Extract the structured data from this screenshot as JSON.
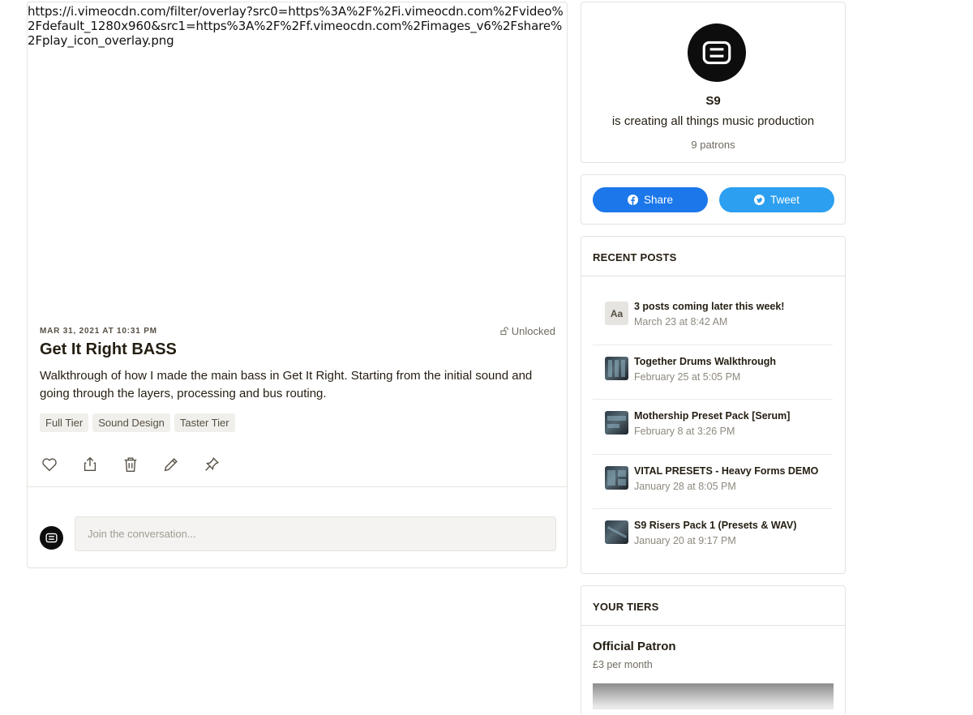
{
  "post": {
    "media_alt_text": "https://i.vimeocdn.com/filter/overlay?src0=https%3A%2F%2Fi.vimeocdn.com%2Fvideo%2Fdefault_1280x960&src1=https%3A%2F%2Ff.vimeocdn.com%2Fimages_v6%2Fshare%2Fplay_icon_overlay.png",
    "date": "MAR 31, 2021 AT 10:31 PM",
    "lock_status": "Unlocked",
    "title": "Get It Right BASS",
    "body": "Walkthrough of how I made the main bass in Get It Right. Starting from the initial sound and going through the layers, processing and bus routing.",
    "tags": [
      "Full Tier",
      "Sound Design",
      "Taster Tier"
    ],
    "actions": [
      "heart-icon",
      "share-icon",
      "trash-icon",
      "pencil-icon",
      "pin-icon"
    ],
    "comment_placeholder": "Join the conversation..."
  },
  "creator": {
    "name": "S9",
    "tagline": "is creating all things music production",
    "patrons": "9 patrons"
  },
  "share": {
    "facebook_label": "Share",
    "twitter_label": "Tweet",
    "facebook_color": "#1b77ea",
    "twitter_color": "#2c9ff0"
  },
  "recent_posts": {
    "heading": "RECENT POSTS",
    "items": [
      {
        "title": "3 posts coming later this week!",
        "date": "March 23 at 8:42 AM",
        "thumb": "Aa"
      },
      {
        "title": "Together Drums Walkthrough",
        "date": "February 25 at 5:05 PM",
        "thumb": ""
      },
      {
        "title": "Mothership Preset Pack [Serum]",
        "date": "February 8 at 3:26 PM",
        "thumb": ""
      },
      {
        "title": "VITAL PRESETS - Heavy Forms DEMO",
        "date": "January 28 at 8:05 PM",
        "thumb": ""
      },
      {
        "title": "S9 Risers Pack 1 (Presets & WAV)",
        "date": "January 20 at 9:17 PM",
        "thumb": ""
      }
    ]
  },
  "tiers": {
    "heading": "YOUR TIERS",
    "name": "Official Patron",
    "price": "£3 per month"
  }
}
